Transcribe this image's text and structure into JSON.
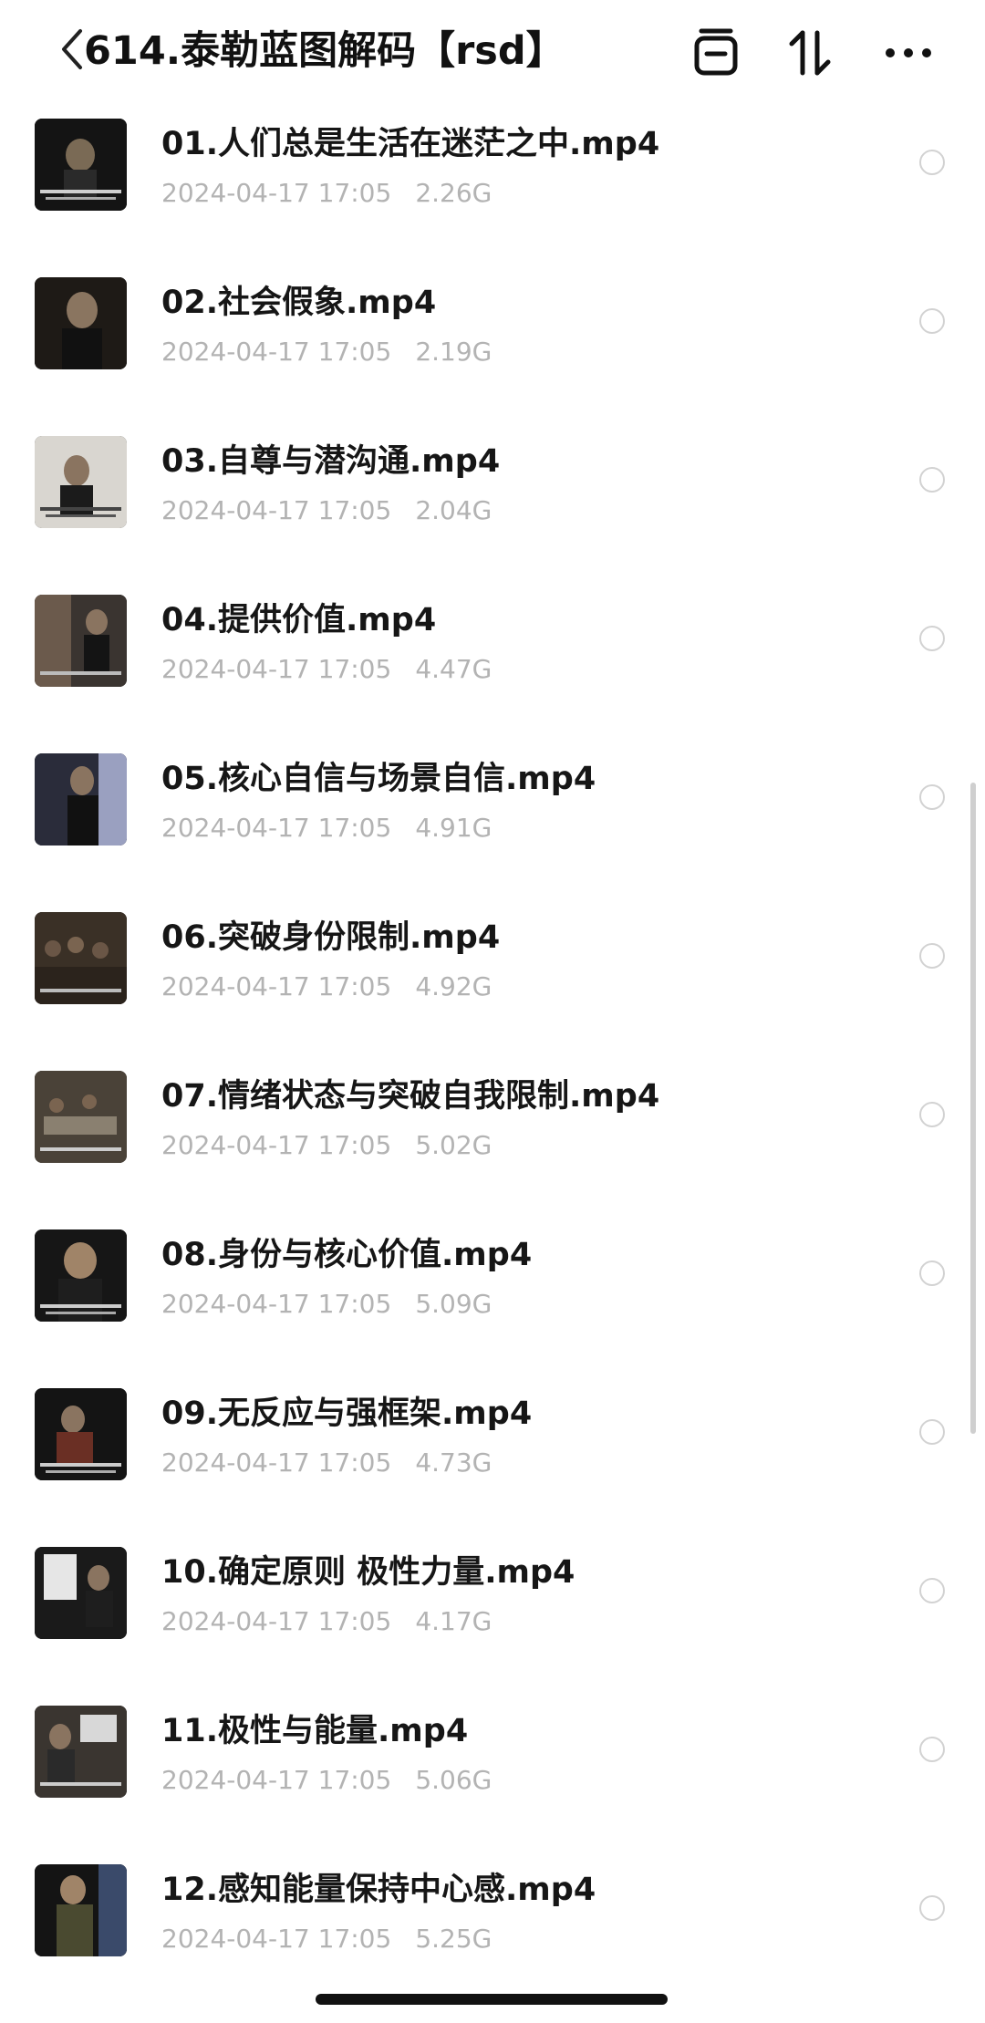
{
  "header": {
    "title": "614.泰勒蓝图解码【rsd】",
    "back_icon": "chevron-left-icon",
    "actions": [
      "select-all-icon",
      "sort-icon",
      "more-icon"
    ]
  },
  "files": [
    {
      "name": "01.人们总是生活在迷茫之中.mp4",
      "date": "2024-04-17 17:05",
      "size": "2.26G"
    },
    {
      "name": "02.社会假象.mp4",
      "date": "2024-04-17 17:05",
      "size": "2.19G"
    },
    {
      "name": "03.自尊与潜沟通.mp4",
      "date": "2024-04-17 17:05",
      "size": "2.04G"
    },
    {
      "name": "04.提供价值.mp4",
      "date": "2024-04-17 17:05",
      "size": "4.47G"
    },
    {
      "name": "05.核心自信与场景自信.mp4",
      "date": "2024-04-17 17:05",
      "size": "4.91G"
    },
    {
      "name": "06.突破身份限制.mp4",
      "date": "2024-04-17 17:05",
      "size": "4.92G"
    },
    {
      "name": "07.情绪状态与突破自我限制.mp4",
      "date": "2024-04-17 17:05",
      "size": "5.02G"
    },
    {
      "name": "08.身份与核心价值.mp4",
      "date": "2024-04-17 17:05",
      "size": "5.09G"
    },
    {
      "name": "09.无反应与强框架.mp4",
      "date": "2024-04-17 17:05",
      "size": "4.73G"
    },
    {
      "name": "10.确定原则 极性力量.mp4",
      "date": "2024-04-17 17:05",
      "size": "4.17G"
    },
    {
      "name": "11.极性与能量.mp4",
      "date": "2024-04-17 17:05",
      "size": "5.06G"
    },
    {
      "name": "12.感知能量保持中心感.mp4",
      "date": "2024-04-17 17:05",
      "size": "5.25G"
    }
  ],
  "colors": {
    "title": "#111111",
    "filename": "#161616",
    "meta": "#b3b3b3",
    "radio_border": "#d2d2d2",
    "scrollbar": "#cfcfcf"
  }
}
